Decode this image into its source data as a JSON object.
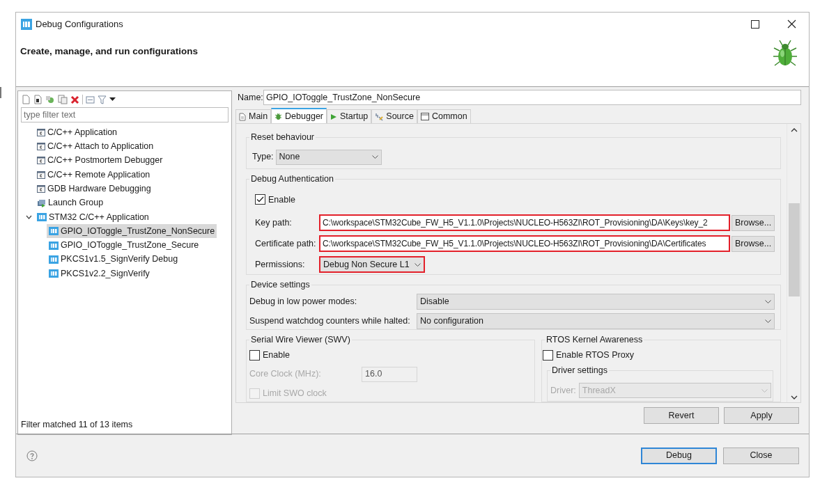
{
  "window": {
    "title": "Debug Configurations"
  },
  "header": {
    "title": "Create, manage, and run configurations"
  },
  "sidebar": {
    "filter": {
      "placeholder": "type filter text"
    },
    "tree": [
      {
        "label": "C/C++ Application",
        "kind": "c",
        "selected": false
      },
      {
        "label": "C/C++ Attach to Application",
        "kind": "c",
        "selected": false
      },
      {
        "label": "C/C++ Postmortem Debugger",
        "kind": "c",
        "selected": false
      },
      {
        "label": "C/C++ Remote Application",
        "kind": "c",
        "selected": false
      },
      {
        "label": "GDB Hardware Debugging",
        "kind": "c",
        "selected": false
      },
      {
        "label": "Launch Group",
        "kind": "group",
        "selected": false
      },
      {
        "label": "STM32 C/C++ Application",
        "kind": "ide",
        "selected": false,
        "expanded": true,
        "children": [
          {
            "label": "GPIO_IOToggle_TrustZone_NonSecure",
            "kind": "ide",
            "selected": true
          },
          {
            "label": "GPIO_IOToggle_TrustZone_Secure",
            "kind": "ide",
            "selected": false
          },
          {
            "label": "PKCS1v1.5_SignVerify Debug",
            "kind": "ide",
            "selected": false
          },
          {
            "label": "PKCS1v2.2_SignVerify",
            "kind": "ide",
            "selected": false
          }
        ]
      }
    ],
    "status": "Filter matched 11 of 13 items"
  },
  "name": {
    "label": "Name:",
    "value": "GPIO_IOToggle_TrustZone_NonSecure"
  },
  "tabs": [
    {
      "label": "Main",
      "selected": false
    },
    {
      "label": "Debugger",
      "selected": true
    },
    {
      "label": "Startup",
      "selected": false
    },
    {
      "label": "Source",
      "selected": false
    },
    {
      "label": "Common",
      "selected": false
    }
  ],
  "reset": {
    "title": "Reset behaviour",
    "type_label": "Type:",
    "type_value": "None"
  },
  "auth": {
    "title": "Debug Authentication",
    "enable": {
      "label": "Enable",
      "checked": true
    },
    "fields": [
      {
        "label": "Key path:",
        "value": "C:\\workspace\\STM32Cube_FW_H5_V1.1.0\\Projects\\NUCLEO-H563ZI\\ROT_Provisioning\\DA\\Keys\\key_2",
        "highlighted": true,
        "button": "Browse..."
      },
      {
        "label": "Certificate path:",
        "value": "C:\\workspace\\STM32Cube_FW_H5_V1.1.0\\Projects\\NUCLEO-H563ZI\\ROT_Provisioning\\DA\\Certificates",
        "highlighted": true,
        "button": "Browse..."
      }
    ],
    "permissions": {
      "label": "Permissions:",
      "value": "Debug Non Secure L1",
      "highlighted": true
    }
  },
  "device": {
    "title": "Device settings",
    "rows": [
      {
        "label": "Debug in low power modes:",
        "value": "Disable"
      },
      {
        "label": "Suspend watchdog counters while halted:",
        "value": "No configuration"
      }
    ]
  },
  "swv": {
    "title": "Serial Wire Viewer (SWV)",
    "enable": {
      "label": "Enable",
      "checked": false
    },
    "core_clock": {
      "label": "Core Clock (MHz):",
      "value": "16.0",
      "disabled": true
    },
    "limit": {
      "label": "Limit SWO clock",
      "checked": false,
      "disabled": true
    }
  },
  "rtos": {
    "title": "RTOS Kernel Awareness",
    "enable": {
      "label": "Enable RTOS Proxy",
      "checked": false
    },
    "driver_settings": {
      "title": "Driver settings",
      "label": "Driver:",
      "value": "ThreadX",
      "disabled": true
    }
  },
  "actions": [
    "Revert",
    "Apply"
  ],
  "buttons": [
    {
      "label": "Debug",
      "default": true
    },
    {
      "label": "Close",
      "default": false
    }
  ]
}
